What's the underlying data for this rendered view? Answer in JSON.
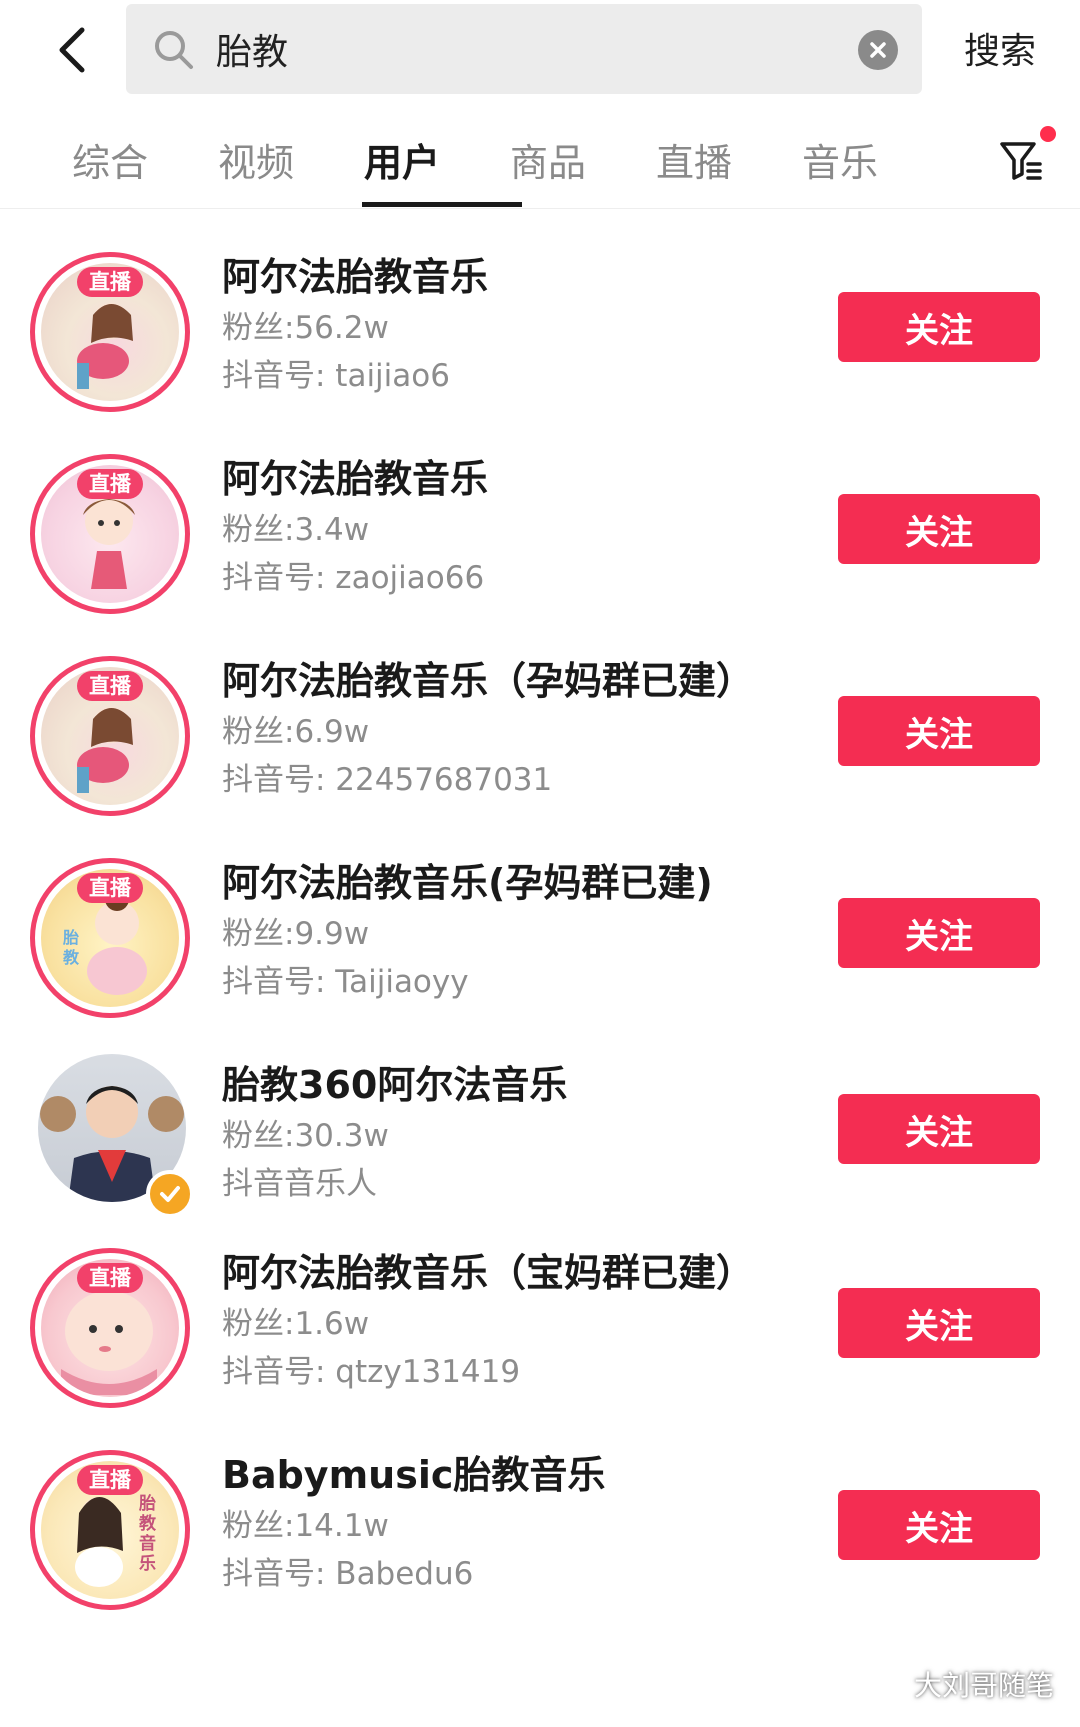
{
  "search": {
    "value": "胎教",
    "button_label": "搜索"
  },
  "tabs": [
    {
      "label": "综合"
    },
    {
      "label": "视频"
    },
    {
      "label": "用户",
      "active": true
    },
    {
      "label": "商品"
    },
    {
      "label": "直播"
    },
    {
      "label": "音乐"
    }
  ],
  "colors": {
    "accent": "#f42d52",
    "live_ring": "#f2416a",
    "verified": "#f5a623"
  },
  "users": [
    {
      "name": "阿尔法胎教音乐",
      "fans": "粉丝:56.2w",
      "account": "抖音号: taijiao6",
      "live_label": "直播",
      "follow_label": "关注"
    },
    {
      "name": "阿尔法胎教音乐",
      "fans": "粉丝:3.4w",
      "account": "抖音号: zaojiao66",
      "live_label": "直播",
      "follow_label": "关注"
    },
    {
      "name": "阿尔法胎教音乐（孕妈群已建）",
      "fans": "粉丝:6.9w",
      "account": "抖音号: 22457687031",
      "live_label": "直播",
      "follow_label": "关注"
    },
    {
      "name": "阿尔法胎教音乐(孕妈群已建)",
      "fans": "粉丝:9.9w",
      "account": "抖音号: Taijiaoyy",
      "live_label": "直播",
      "follow_label": "关注"
    },
    {
      "name": "胎教360阿尔法音乐",
      "fans": "粉丝:30.3w",
      "account": "抖音音乐人",
      "verified": true,
      "follow_label": "关注"
    },
    {
      "name": "阿尔法胎教音乐（宝妈群已建）",
      "fans": "粉丝:1.6w",
      "account": "抖音号: qtzy131419",
      "live_label": "直播",
      "follow_label": "关注"
    },
    {
      "name": "Babymusic胎教音乐",
      "fans": "粉丝:14.1w",
      "account": "抖音号: Babedu6",
      "live_label": "直播",
      "follow_label": "关注"
    }
  ],
  "watermark": {
    "text": "大刘哥随笔"
  }
}
